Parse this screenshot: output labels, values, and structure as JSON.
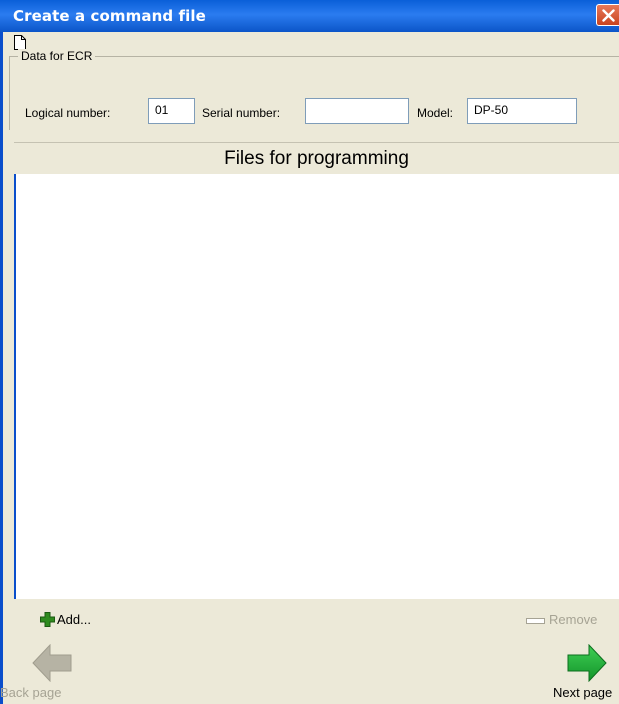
{
  "window": {
    "title": "Create a command file"
  },
  "toolbar": {
    "new_icon": "new-document-icon"
  },
  "ecr": {
    "legend": "Data for ECR",
    "logical_label": "Logical number:",
    "logical_value": "01",
    "serial_label": "Serial number:",
    "serial_value": "",
    "model_label": "Model:",
    "model_value": "DP-50"
  },
  "files": {
    "header": "Files for programming",
    "items": []
  },
  "actions": {
    "add_label": "Add...",
    "remove_label": "Remove",
    "back_label": "Back page",
    "next_label": "Next page"
  },
  "colors": {
    "titlebar": "#0a5fd8",
    "window_bg": "#ece9d8",
    "close": "#d9562d",
    "add_icon": "#2e8b1e",
    "next_arrow": "#1ea832",
    "disabled": "#a6a394"
  }
}
